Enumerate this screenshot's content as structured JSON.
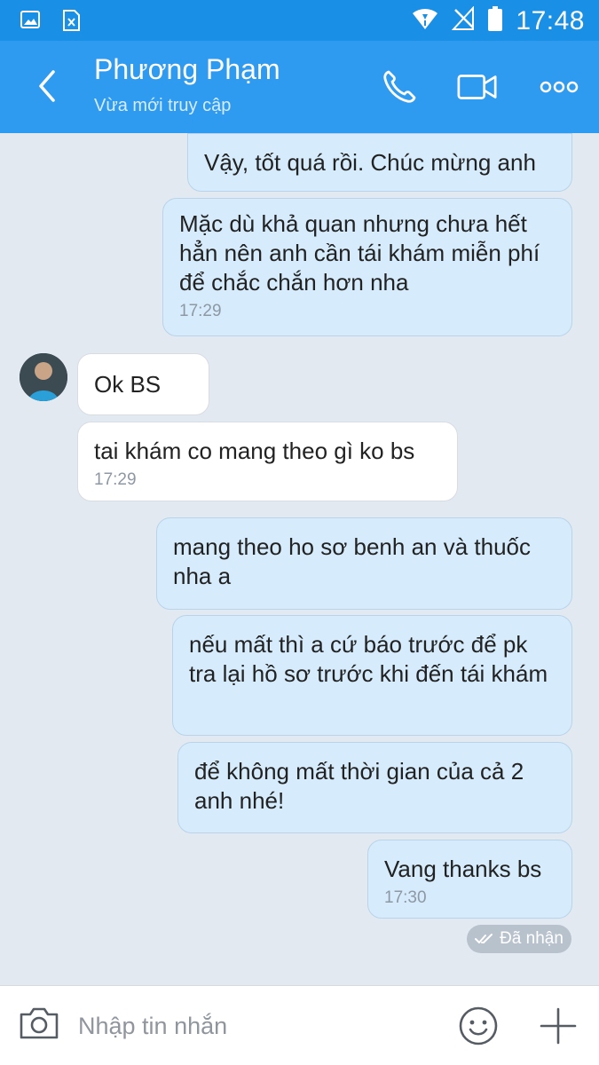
{
  "status_bar": {
    "time": "17:48",
    "icons": [
      "image-icon",
      "sim-error-icon",
      "wifi-icon",
      "no-signal-icon",
      "battery-icon"
    ]
  },
  "header": {
    "contact_name": "Phương Phạm",
    "contact_status": "Vừa mới truy cập",
    "icons": [
      "back-arrow-icon",
      "phone-icon",
      "video-camera-icon",
      "more-options-icon"
    ]
  },
  "messages": [
    {
      "direction": "out",
      "text": "Vậy, tốt quá rồi. Chúc mừng anh",
      "time": ""
    },
    {
      "direction": "out",
      "text": "Mặc dù khả quan nhưng chưa hết hẳn nên anh cần tái khám miễn phí để chắc chắn hơn nha",
      "time": "17:29"
    },
    {
      "direction": "in",
      "text": "Ok BS",
      "time": ""
    },
    {
      "direction": "in",
      "text": "tai khám co mang theo gì ko bs",
      "time": "17:29"
    },
    {
      "direction": "out",
      "text": "mang theo ho sơ benh an và thuốc nha a",
      "time": ""
    },
    {
      "direction": "out",
      "text": "nếu mất thì a cứ báo trước để pk tra lại hồ sơ trước khi đến tái khám",
      "time": ""
    },
    {
      "direction": "out",
      "text": "để không mất thời gian của cả 2 anh nhé!",
      "time": ""
    },
    {
      "direction": "out",
      "text": "Vang thanks bs",
      "time": "17:30"
    }
  ],
  "receipt": {
    "label": "Đã nhận",
    "icon": "double-check-icon"
  },
  "input_bar": {
    "placeholder": "Nhập tin nhắn",
    "icons": [
      "camera-icon",
      "emoji-icon",
      "plus-icon"
    ]
  },
  "colors": {
    "status_bar": "#1a8fe6",
    "header": "#2f9bf0",
    "background": "#e2e9f1",
    "outgoing_bubble": "#d6ecfc",
    "incoming_bubble": "#ffffff"
  }
}
